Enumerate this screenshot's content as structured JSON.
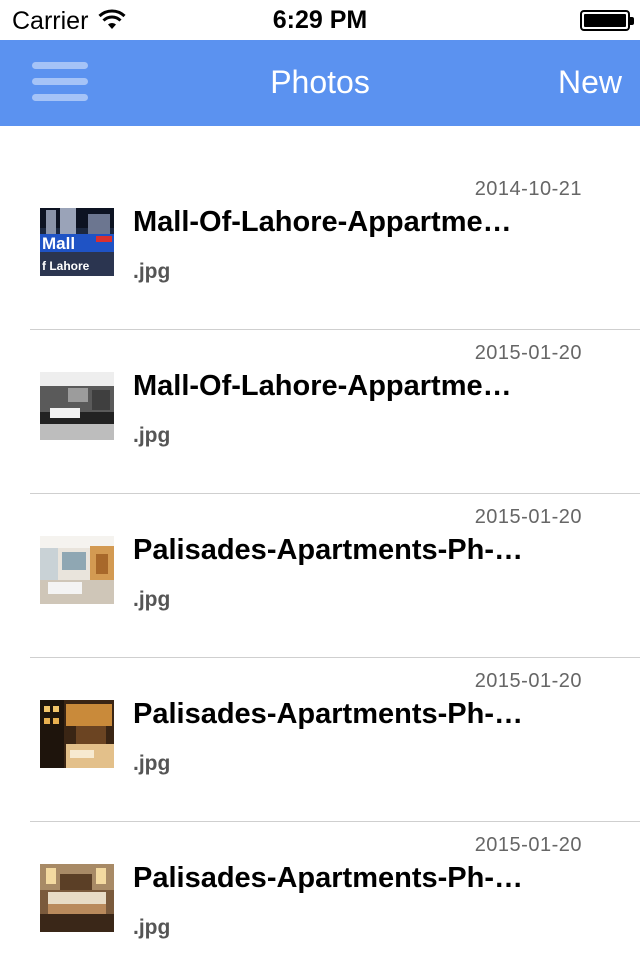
{
  "status_bar": {
    "carrier": "Carrier",
    "time": "6:29 PM",
    "icons": [
      "wifi-icon",
      "battery-icon"
    ]
  },
  "nav": {
    "title": "Photos",
    "right_label": "New",
    "left_icon": "hamburger-menu-icon",
    "bar_color": "#5b92f0"
  },
  "photos": [
    {
      "date": "2014-10-21",
      "name": "Mall-Of-Lahore-Appartme…",
      "ext": ".jpg"
    },
    {
      "date": "2015-01-20",
      "name": "Mall-Of-Lahore-Appartme…",
      "ext": ".jpg"
    },
    {
      "date": "2015-01-20",
      "name": "Palisades-Apartments-Ph-…",
      "ext": ".jpg"
    },
    {
      "date": "2015-01-20",
      "name": "Palisades-Apartments-Ph-…",
      "ext": ".jpg"
    },
    {
      "date": "2015-01-20",
      "name": "Palisades-Apartments-Ph-…",
      "ext": ".jpg"
    }
  ]
}
